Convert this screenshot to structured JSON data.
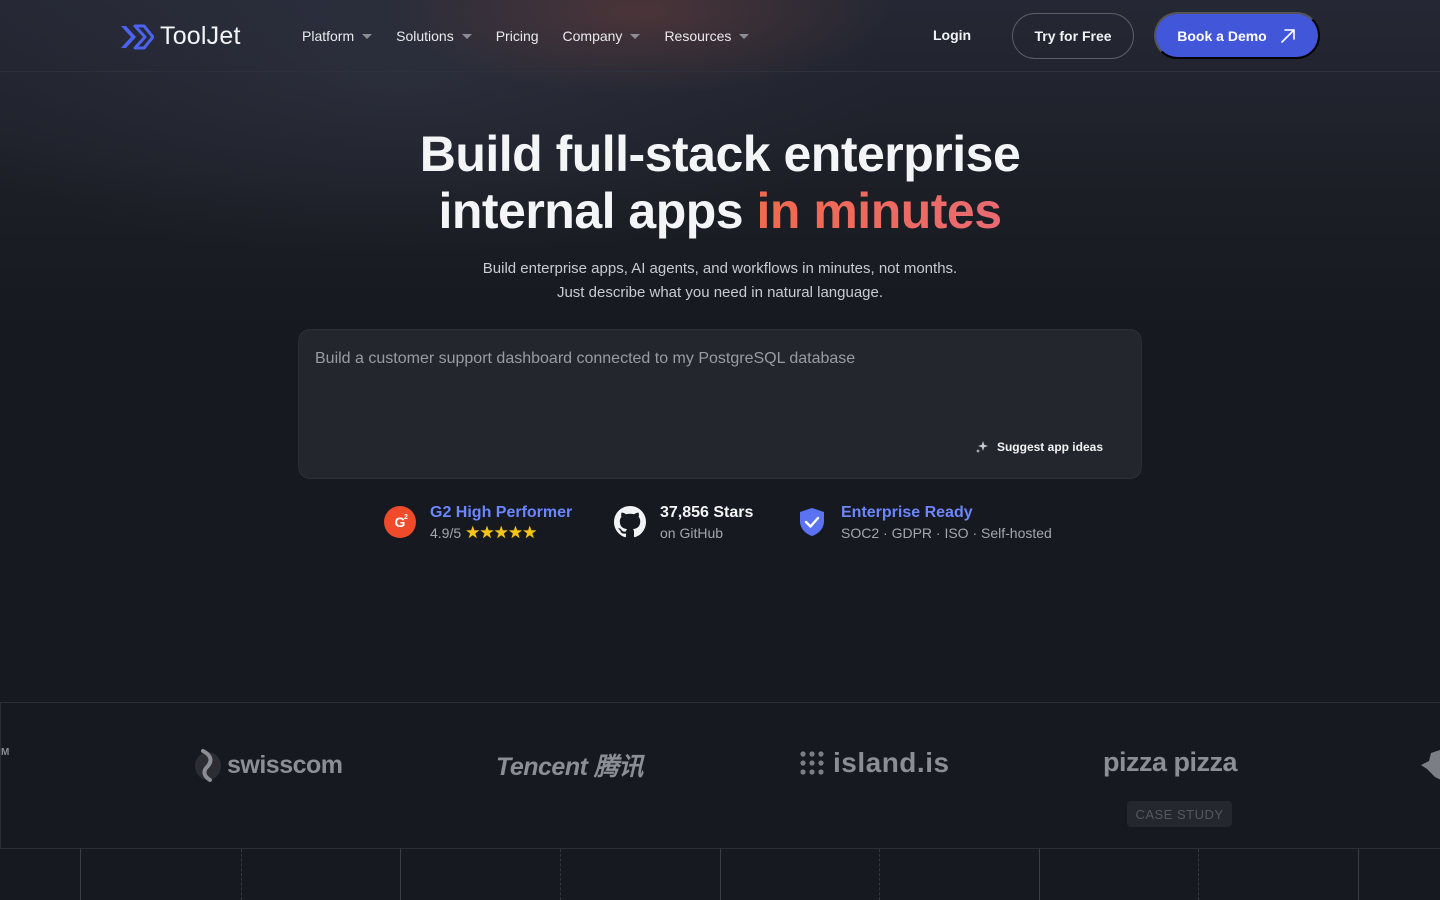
{
  "brand": {
    "name": "ToolJet",
    "accent": "#4156d9"
  },
  "nav": {
    "items": [
      {
        "label": "Platform",
        "dropdown": true
      },
      {
        "label": "Solutions",
        "dropdown": true
      },
      {
        "label": "Pricing",
        "dropdown": false
      },
      {
        "label": "Company",
        "dropdown": true
      },
      {
        "label": "Resources",
        "dropdown": true
      }
    ],
    "login": "Login",
    "try_free": "Try for Free",
    "book_demo": "Book a Demo"
  },
  "hero": {
    "title_line1": "Build full-stack enterprise",
    "title_line2_plain": "internal apps ",
    "title_line2_accent": "in minutes",
    "subtitle": "Build enterprise apps, AI agents, and workflows in minutes, not months. Just describe what you need in natural language.",
    "prompt_placeholder": "Build a customer support dashboard connected to my PostgreSQL database",
    "suggest_label": "Suggest app ideas"
  },
  "badges": {
    "g2": {
      "title": "G2 High Performer",
      "rating": "4.9/5",
      "stars": "★★★★★",
      "icon": "g2-icon"
    },
    "github": {
      "title": "37,856 Stars",
      "sub": "on GitHub",
      "icon": "github-icon"
    },
    "enterprise": {
      "title": "Enterprise Ready",
      "sub": "SOC2 · GDPR · ISO · Self-hosted",
      "icon": "shield-check-icon"
    }
  },
  "customer_logos": {
    "items": [
      "swisscom",
      "Tencent 腾讯",
      "island.is",
      "pizza pizza"
    ],
    "case_study_label": "CASE STUDY",
    "partial_left": "M"
  }
}
